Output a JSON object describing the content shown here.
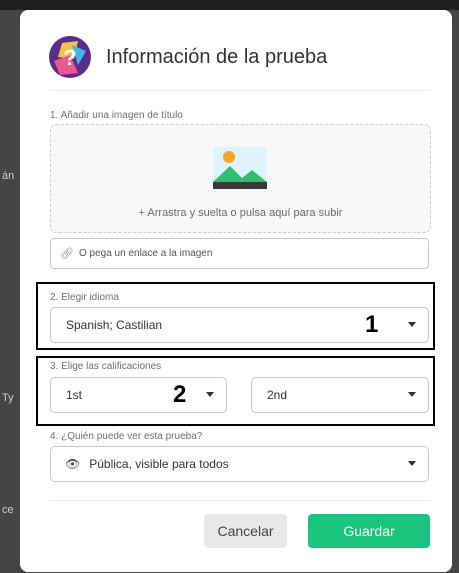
{
  "background": {
    "edge_text": [
      "án",
      "Ty",
      "ce"
    ]
  },
  "modal": {
    "title": "Información de la prueba",
    "header_icon": "quiz-icon",
    "title_image": {
      "label": "1. Añadir una imagen de título",
      "icon": "image-icon",
      "upload_text": "+ Arrastra y suelta o pulsa aquí para subir",
      "link_icon": "link-icon",
      "link_placeholder": "O pega un enlace a la imagen"
    },
    "language": {
      "label": "2. Elegir idioma",
      "value": "Spanish; Castilian"
    },
    "grades": {
      "label": "3. Elige las calificaciones",
      "from_value": "1st",
      "to_value": "2nd"
    },
    "visibility": {
      "label": "4. ¿Quién puede ver esta prueba?",
      "icon": "eye-icon",
      "value": "Pública, visible para todos"
    },
    "buttons": {
      "cancel": "Cancelar",
      "save": "Guardar"
    }
  },
  "annotations": {
    "language_marker": "1",
    "grades_marker": "2"
  },
  "colors": {
    "save_button": "#1bc47d",
    "cancel_button": "#e8e8e8",
    "accent_purple": "#5b2d8a"
  }
}
